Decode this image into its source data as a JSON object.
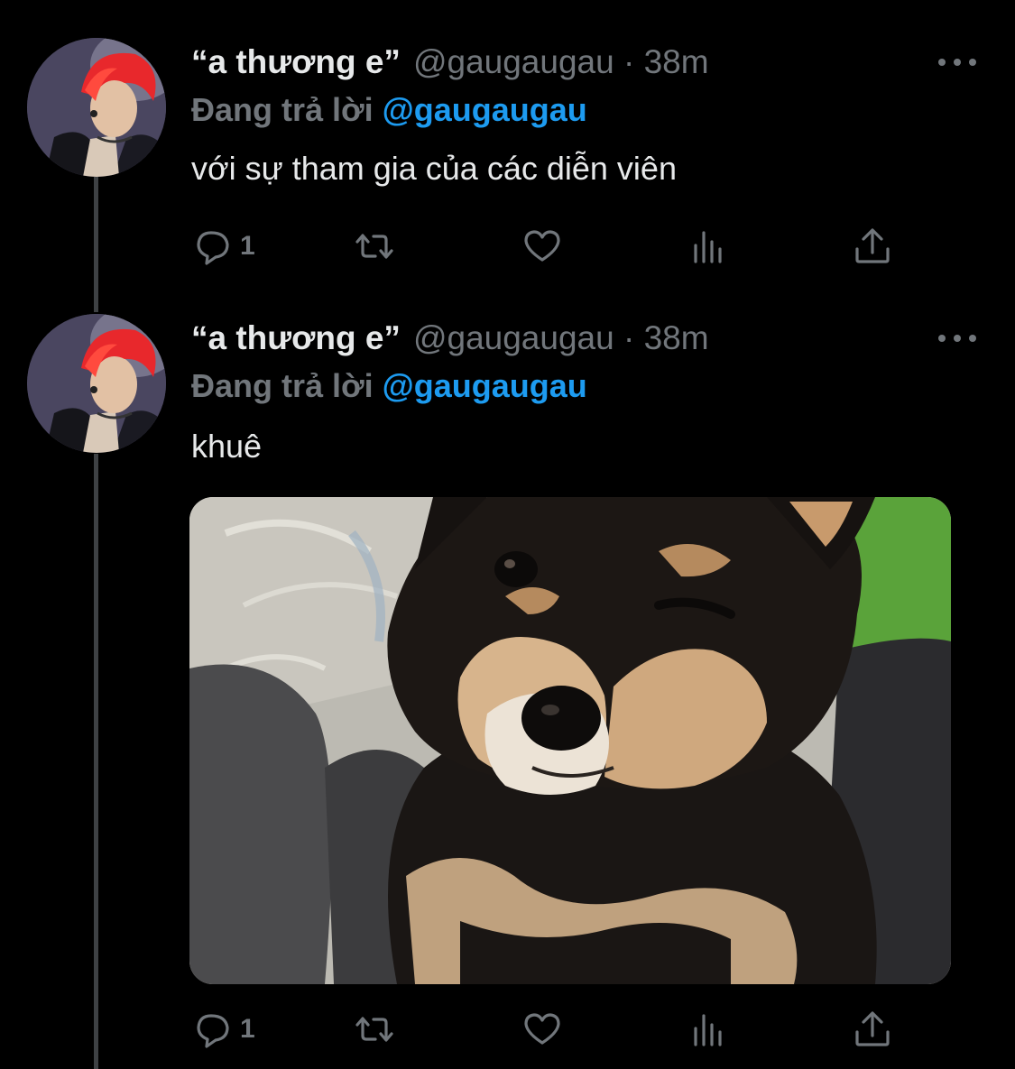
{
  "colors": {
    "background": "#000000",
    "text_primary": "#e7e9ea",
    "text_secondary": "#71767b",
    "accent": "#1d9bf0",
    "thread_line": "#3e4144"
  },
  "tweets": [
    {
      "display_name": "“a thương e”",
      "handle": "@gaugaugau",
      "separator": "·",
      "time": "38m",
      "reply_prefix": "Đang trả lời",
      "reply_mention": "@gaugaugau",
      "text": "với sự tham gia của các diễn viên",
      "reply_count": "1",
      "icons": [
        "reply-icon",
        "retweet-icon",
        "like-icon",
        "views-icon",
        "share-icon",
        "more-icon"
      ]
    },
    {
      "display_name": "“a thương e”",
      "handle": "@gaugaugau",
      "separator": "·",
      "time": "38m",
      "reply_prefix": "Đang trả lời",
      "reply_mention": "@gaugaugau",
      "text": "khuê",
      "reply_count": "1",
      "icons": [
        "reply-icon",
        "retweet-icon",
        "like-icon",
        "views-icon",
        "share-icon",
        "more-icon"
      ],
      "media": "shiba-inu-winking-photo"
    }
  ]
}
